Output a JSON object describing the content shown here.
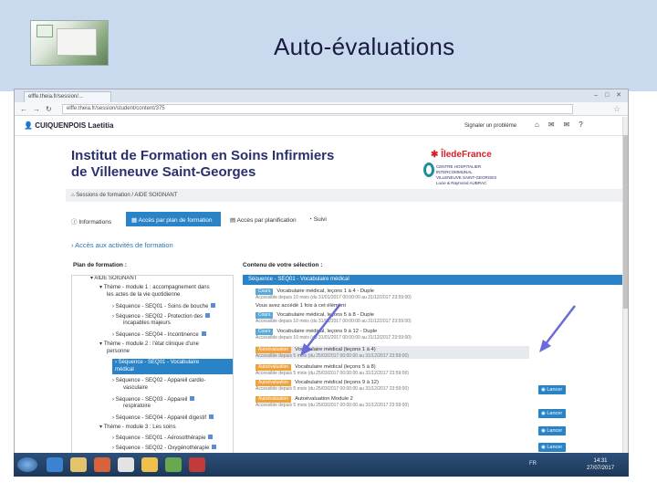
{
  "slide": {
    "title": "Auto-évaluations"
  },
  "browser": {
    "tab_label": "elffe.theia.fr/session/...",
    "url": "elffe.theia.fr/session/student/content/375",
    "window_controls": "– □ ✕"
  },
  "app": {
    "user_name": "CUIQUENPOIS Laetitia",
    "report_link": "Signaler un problème",
    "icons": [
      "home-icon",
      "envelope-icon",
      "mail-icon",
      "question-icon"
    ]
  },
  "banner": {
    "title_line1": "Institut de Formation en Soins Infirmiers",
    "title_line2": "de Villeneuve Saint-Georges",
    "region_logo": "ÎledeFrance",
    "hospital_lines": [
      "CENTRE HOSPITALIER",
      "INTERCOMMUNAL",
      "VILLENEUVE SAINT-GEORGES",
      "Lucie & Raymond AUBRAC"
    ]
  },
  "breadcrumb": {
    "home": "Sessions de formation",
    "separator": "/",
    "current": "AIDE SOIGNANT"
  },
  "nav_tabs": [
    {
      "label": "Informations"
    },
    {
      "label": "Accès par plan de formation"
    },
    {
      "label": "Accès par planification"
    },
    {
      "label": "Suivi"
    }
  ],
  "acces_link": "Accès aux activités de formation",
  "plan": {
    "title": "Plan de formation :",
    "rows": [
      {
        "text": "AIDE SOIGNANT"
      },
      {
        "text": "Thème - module 1 : accompagnement dans"
      },
      {
        "text": "les actes de la vie quotidienne"
      },
      {
        "text": "Séquence - SEQ01 - Soins de bouche"
      },
      {
        "text": "Séquence - SEQ02 - Protection des"
      },
      {
        "text": "incapables majeurs"
      },
      {
        "text": "Séquence - SEQ04 - Incontinence"
      },
      {
        "text": "Thème - module 2 : l'état clinique d'une"
      },
      {
        "text": "personne"
      },
      {
        "text": "Séquence - SEQ01 - Vocabulaire"
      },
      {
        "text": "médical"
      },
      {
        "text": "Séquence - SEQ02 - Appareil cardio-"
      },
      {
        "text": "vasculaire"
      },
      {
        "text": "Séquence - SEQ03 - Appareil"
      },
      {
        "text": "respiratoire"
      },
      {
        "text": "Séquence - SEQ04 - Appareil digestif"
      },
      {
        "text": "Thème - module 3 : Les soins"
      },
      {
        "text": "Séquence - SEQ01 - Aérosolthérapie"
      },
      {
        "text": "Séquence - SEQ02 - Oxygénothérapie"
      }
    ]
  },
  "contenu": {
    "title": "Contenu de votre sélection :",
    "header": "Séquence - SEQ01 - Vocabulaire médical",
    "items": [
      {
        "badge": "Cours",
        "line": "Vocabulaire médical, leçons 1 à 4 - Duple",
        "sub": "Accessible depuis 10 mois (du 31/01/2017 00:00:00 au 31/12/2017 23:59:00)"
      },
      {
        "badge": "",
        "line": "Vous avez accédé 1 fois à cet élément",
        "sub": ""
      },
      {
        "badge": "Cours",
        "line": "Vocabulaire médical, leçons 5 à 8 - Duple",
        "sub": "Accessible depuis 10 mois (du 31/01/2017 00:00:00 au 31/12/2017 23:59:00)"
      },
      {
        "badge": "Cours",
        "line": "Vocabulaire médical, leçons 9 à 12 - Duple",
        "sub": "Accessible depuis 10 mois (du 31/01/2017 00:00:00 au 31/12/2017 23:59:00)"
      },
      {
        "badge": "Autoévaluation",
        "line": "Vocabulaire médical (leçons 1 à 4)",
        "sub": "Accessible depuis 5 mois (du 25/03/2017 00:00:00 au 31/12/2017 23:59:00)"
      },
      {
        "badge": "Autoévaluation",
        "line": "Vocabulaire médical (leçons 5 à 8)",
        "sub": "Accessible depuis 5 mois (du 25/03/2017 00:00:00 au 31/12/2017 23:59:00)"
      },
      {
        "badge": "Autoévaluation",
        "line": "Vocabulaire médical (leçons 9 à 12)",
        "sub": "Accessible depuis 5 mois (du 25/03/2017 00:00:00 au 31/12/2017 23:59:00)"
      },
      {
        "badge": "Autoévaluation",
        "line": "Autoévaluation Module 2",
        "sub": "Accessible depuis 5 mois (du 25/03/2017 00:00:00 au 31/12/2017 23:59:00)"
      }
    ],
    "lancer_label": "Lancer"
  },
  "taskbar": {
    "lang": "FR",
    "time": "14:31",
    "date": "27/07/2017"
  },
  "colors": {
    "accent": "#2a83c7",
    "autoeval": "#f0a23a",
    "cours": "#5aa9d6",
    "slide_band": "#c9d9ee",
    "arrow": "#6a6adb"
  }
}
